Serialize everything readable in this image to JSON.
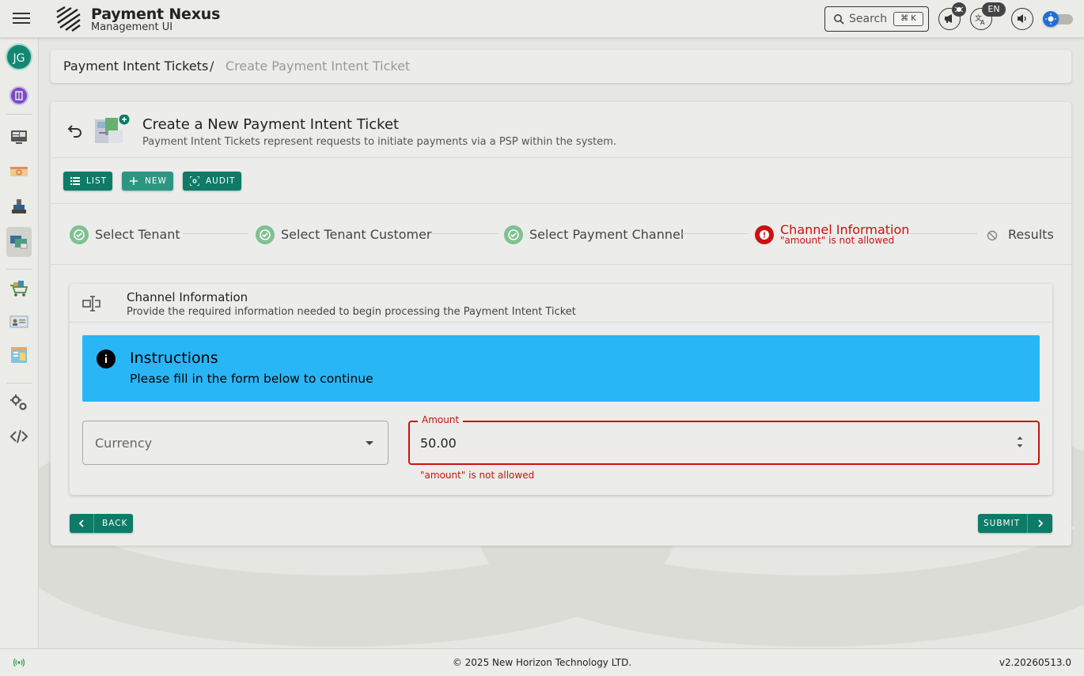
{
  "app": {
    "title": "Payment Nexus",
    "subtitle": "Management UI"
  },
  "topbar": {
    "search_label": "Search",
    "search_shortcut": "⌘ K",
    "language": "EN"
  },
  "sidebar": {
    "avatar_initials": "JG",
    "items": [
      {
        "name": "dashboard-icon"
      },
      {
        "name": "banner-icon"
      },
      {
        "name": "terminal-icon"
      },
      {
        "name": "payment-intent-icon",
        "active": true
      },
      {
        "name": "cart-icon"
      },
      {
        "name": "id-card-icon"
      },
      {
        "name": "report-icon"
      },
      {
        "name": "settings-gears-icon"
      },
      {
        "name": "code-icon"
      }
    ]
  },
  "breadcrumb": {
    "root": "Payment Intent Tickets",
    "separator": "/",
    "current": "Create Payment Intent Ticket"
  },
  "page": {
    "title": "Create a New Payment Intent Ticket",
    "subtitle": "Payment Intent Tickets represent requests to initiate payments via a PSP within the system."
  },
  "toolbar": {
    "list_label": "LIST",
    "new_label": "NEW",
    "audit_label": "AUDIT"
  },
  "stepper": {
    "steps": [
      {
        "label": "Select Tenant",
        "status": "complete"
      },
      {
        "label": "Select Tenant Customer",
        "status": "complete"
      },
      {
        "label": "Select Payment Channel",
        "status": "complete"
      },
      {
        "label": "Channel Information",
        "status": "error",
        "error": "\"amount\" is not allowed"
      },
      {
        "label": "Results",
        "status": "disabled"
      }
    ]
  },
  "section": {
    "title": "Channel Information",
    "subtitle": "Provide the required information needed to begin processing the Payment Intent Ticket"
  },
  "alert": {
    "title": "Instructions",
    "text": "Please fill in the form below to continue"
  },
  "form": {
    "currency_placeholder": "Currency",
    "amount_label": "Amount",
    "amount_value": "50.00",
    "amount_error": "\"amount\" is not allowed"
  },
  "actions": {
    "back_label": "BACK",
    "submit_label": "SUBMIT"
  },
  "footer": {
    "copyright": "© 2025 New Horizon Technology LTD.",
    "version": "v2.20260513.0"
  },
  "colors": {
    "primary": "#0d7b67",
    "error": "#cc1111",
    "info": "#29b6f6",
    "success": "#7fc190"
  }
}
